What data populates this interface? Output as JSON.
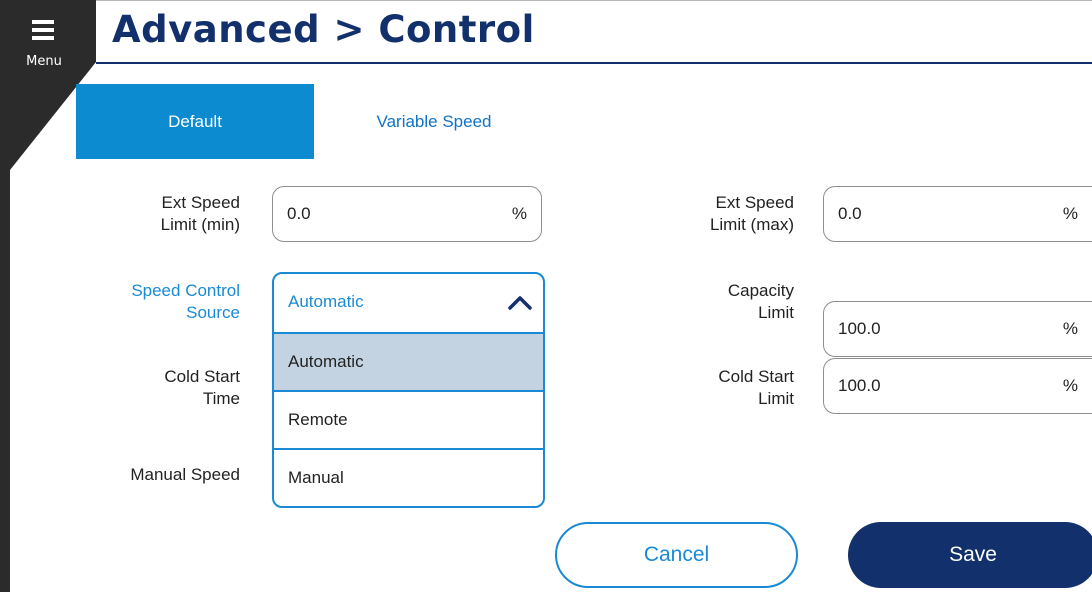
{
  "menu": {
    "label": "Menu",
    "icon": "hamburger-icon"
  },
  "page": {
    "title": "Advanced > Control"
  },
  "tabs": [
    {
      "label": "Default",
      "active": true
    },
    {
      "label": "Variable Speed",
      "active": false
    }
  ],
  "fields": {
    "ext_speed_min": {
      "label_line1": "Ext Speed",
      "label_line2": "Limit (min)",
      "value": "0.0",
      "unit": "%"
    },
    "ext_speed_max": {
      "label_line1": "Ext Speed",
      "label_line2": "Limit (max)",
      "value": "0.0",
      "unit": "%"
    },
    "speed_control_source": {
      "label_line1": "Speed Control",
      "label_line2": "Source",
      "selected": "Automatic"
    },
    "capacity_limit": {
      "label_line1": "Capacity",
      "label_line2": "Limit",
      "value": "100.0",
      "unit": "%"
    },
    "cold_start_time": {
      "label_line1": "Cold Start",
      "label_line2": "Time"
    },
    "cold_start_limit": {
      "label_line1": "Cold Start",
      "label_line2": "Limit",
      "value": "100.0",
      "unit": "%"
    },
    "manual_speed": {
      "label": "Manual Speed"
    }
  },
  "dropdown_options": [
    "Automatic",
    "Remote",
    "Manual"
  ],
  "buttons": {
    "cancel": "Cancel",
    "save": "Save"
  },
  "colors": {
    "brand_navy": "#12306b",
    "accent_blue": "#1a8ad4",
    "tab_active": "#0c8bd0",
    "option_highlight": "#c3d3e2"
  }
}
